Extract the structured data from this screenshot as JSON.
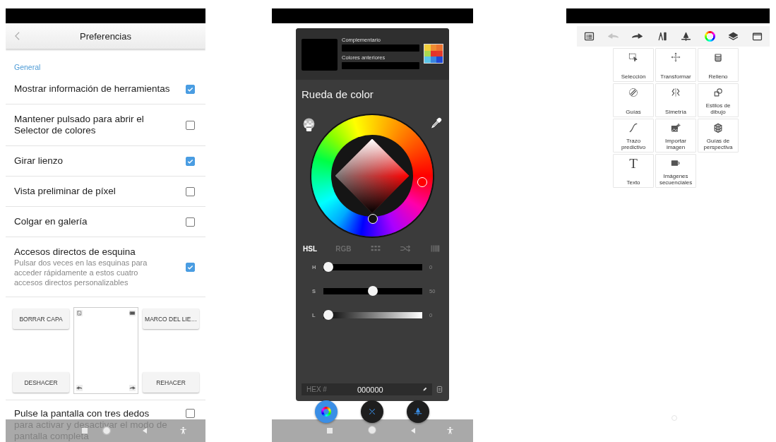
{
  "preferences": {
    "title": "Preferencias",
    "section": "General",
    "options": [
      {
        "label": "Mostrar información de herramientas",
        "checked": true
      },
      {
        "label": "Mantener pulsado para abrir el Selector de colores",
        "checked": false
      },
      {
        "label": "Girar lienzo",
        "checked": true
      },
      {
        "label": "Vista preliminar de píxel",
        "checked": false
      },
      {
        "label": "Colgar en galería",
        "checked": false
      },
      {
        "label": "Accesos directos de esquina",
        "description": "Pulsar dos veces en las esquinas para acceder rápidamente a estos cuatro accesos directos personalizables",
        "checked": true
      }
    ],
    "shortcuts": {
      "top_left": "BORRAR CAPA",
      "top_right": "MARCO DEL LIE…",
      "bottom_left": "DESHACER",
      "bottom_right": "REHACER"
    },
    "last_option": {
      "label": "Pulse la pantalla con tres dedos para activar y desactivar el modo de pantalla completa",
      "checked": false
    }
  },
  "color_picker": {
    "complementary_label": "Complementario",
    "previous_label": "Colores anteriores",
    "palette": [
      {
        "color": "#f2cf3c"
      },
      {
        "color": "#ef8c32"
      },
      {
        "color": "#ec7330"
      },
      {
        "color": "#a9d84f"
      },
      {
        "color": "#e5332b"
      },
      {
        "color": "#e33a2a"
      },
      {
        "color": "#5cc6ea"
      },
      {
        "color": "#3a86df"
      },
      {
        "color": "#1f48d6"
      }
    ],
    "title": "Rueda de color",
    "modes": [
      {
        "kind": "text",
        "label": "HSL",
        "selected": true
      },
      {
        "kind": "text",
        "label": "RGB",
        "selected": false
      },
      {
        "kind": "grid",
        "selected": false
      },
      {
        "kind": "shuffle",
        "selected": false
      },
      {
        "kind": "bars",
        "selected": false
      }
    ],
    "sliders": [
      {
        "label": "H",
        "kind": "plain",
        "level": 0,
        "reading": "0"
      },
      {
        "label": "S",
        "kind": "plain",
        "level": 0.5,
        "reading": "50"
      },
      {
        "label": "L",
        "kind": "gradient",
        "level": 0,
        "reading": "0"
      }
    ],
    "hex_label": "HEX #",
    "hex_value": "000000",
    "dock": [
      {
        "selected": true
      },
      {
        "selected": false
      },
      {
        "selected": false
      }
    ]
  },
  "tools": {
    "toolbar": [
      {
        "disabled": false
      },
      {
        "disabled": true
      },
      {
        "disabled": false
      },
      {
        "disabled": false
      },
      {
        "disabled": false
      },
      {
        "disabled": false
      },
      {
        "disabled": false
      },
      {
        "disabled": false
      }
    ],
    "items": [
      {
        "label": "Selección"
      },
      {
        "label": "Transformar"
      },
      {
        "label": "Relleno"
      },
      {
        "label": "Guías"
      },
      {
        "label": "Simetría"
      },
      {
        "label": "Estilos de dibujo"
      },
      {
        "label": "Trazo predictivo"
      },
      {
        "label": "Importar imagen"
      },
      {
        "label": "Guías de perspectiva"
      },
      {
        "glyph": "T",
        "label": "Texto"
      },
      {
        "label": "Imágenes secuenciales"
      }
    ]
  }
}
